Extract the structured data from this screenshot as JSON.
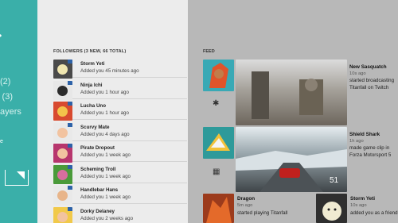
{
  "nav": {
    "items": [
      "(2)",
      "s (3)",
      "ayers"
    ],
    "small_text": "e"
  },
  "followers": {
    "header": "FOLLOWERS (3 NEW, 66 TOTAL)",
    "list": [
      {
        "name": "Storm Yeti",
        "sub": "Added you 45 minutes ago",
        "bg": "#4a4a4a",
        "head": "#f0e6b0"
      },
      {
        "name": "Ninja Ichi",
        "sub": "Added you 1 hour ago",
        "bg": "#e7e7e7",
        "head": "#2b2b2b"
      },
      {
        "name": "Lucha Uno",
        "sub": "Added you 1 hour ago",
        "bg": "#d84a2f",
        "head": "#f3c24a"
      },
      {
        "name": "Scurvy Mate",
        "sub": "Added you 4 days ago",
        "bg": "#e9e9e9",
        "head": "#f2c3a0"
      },
      {
        "name": "Pirate Dropout",
        "sub": "Added you 1 week ago",
        "bg": "#b7366d",
        "head": "#f2c3a0"
      },
      {
        "name": "Scheming Troll",
        "sub": "Added you 1 week ago",
        "bg": "#4a9a3a",
        "head": "#d86e9e"
      },
      {
        "name": "Handlebar Hans",
        "sub": "Added you 1 week ago",
        "bg": "#e9e9e9",
        "head": "#e8b58a"
      },
      {
        "name": "Dorky Delaney",
        "sub": "Added you 2 weeks ago",
        "bg": "#f1c94a",
        "head": "#f2c3a0"
      }
    ]
  },
  "feed": {
    "header": "FEED",
    "cards": [
      {
        "title": "New Sasquatch",
        "meta": "10s ago",
        "desc": "started broadcasting Titanfall on Twitch"
      },
      {
        "title": "Shield Shark",
        "meta": "1h ago",
        "desc": "made game clip in Forza Motorsport 5"
      },
      {
        "title": "Dragon",
        "meta": "5m ago",
        "desc": "started playing Titanfall"
      },
      {
        "title": "Storm Yeti",
        "meta": "10s ago",
        "desc": "added you as a friend"
      }
    ]
  },
  "colors": {
    "accent": "#3aafa9",
    "badge": "#2d62a8"
  }
}
